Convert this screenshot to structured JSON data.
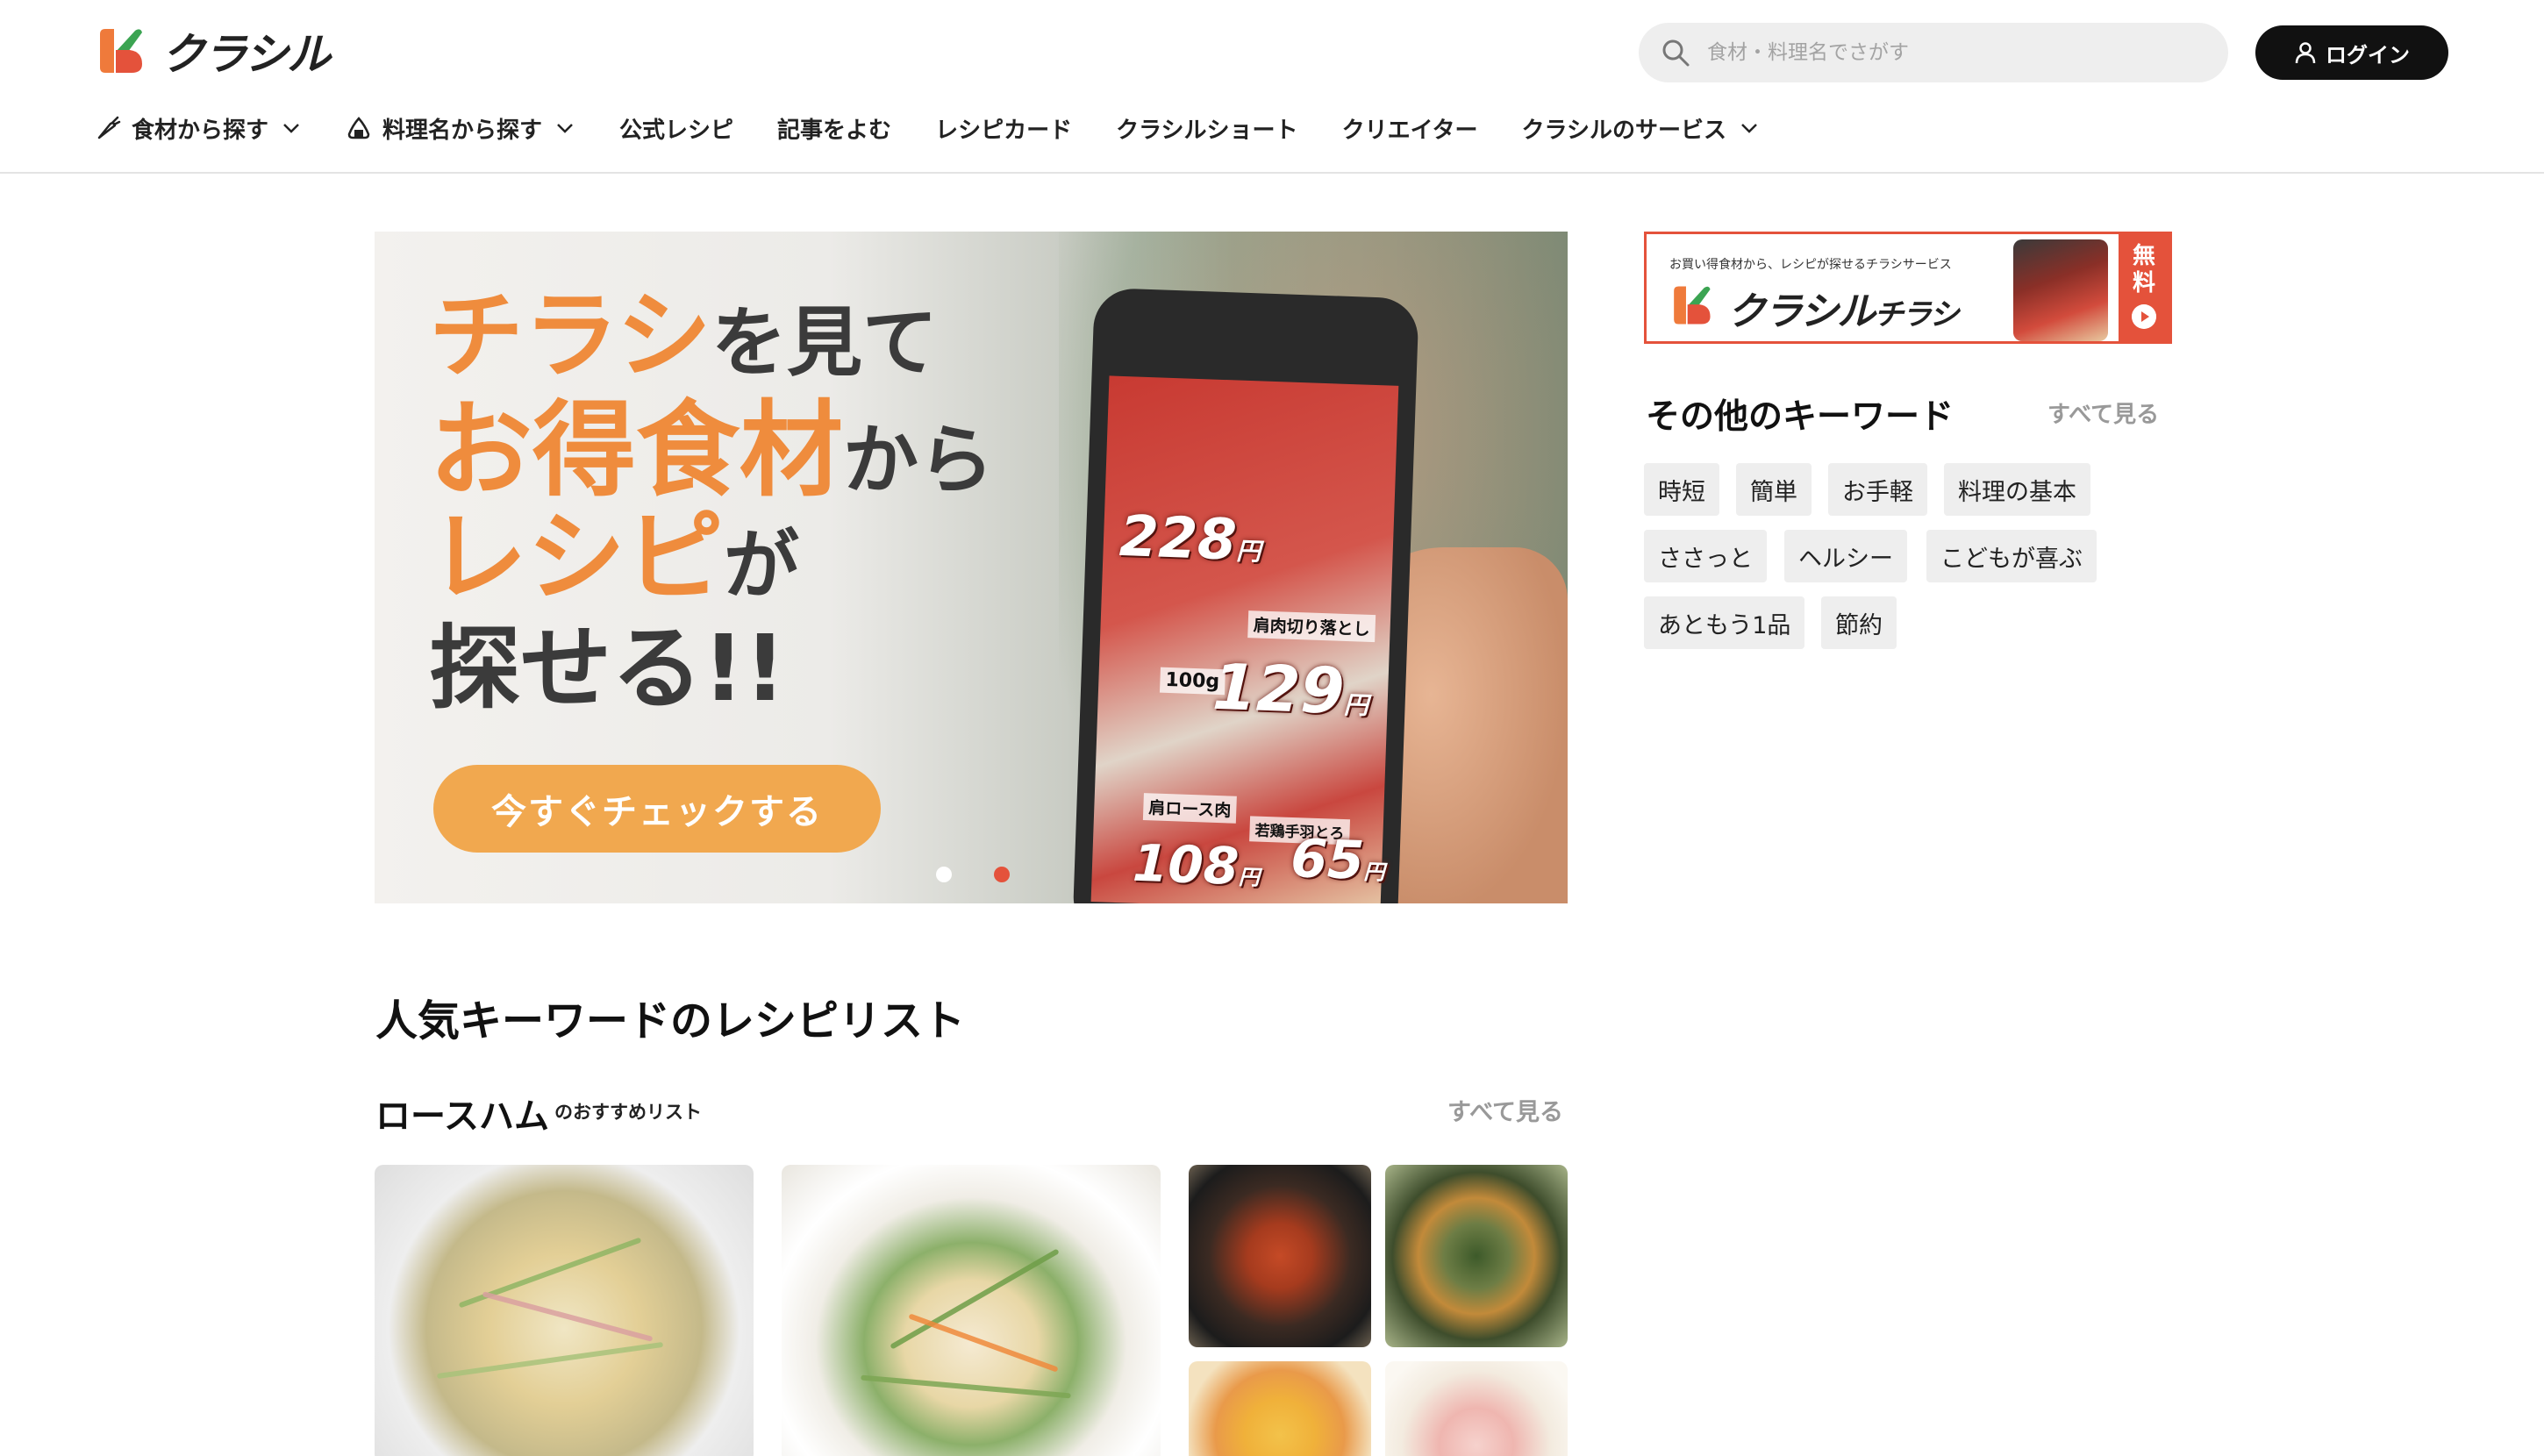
{
  "header": {
    "logo_text": "クラシル",
    "search_placeholder": "食材・料理名でさがす",
    "login_label": "ログイン"
  },
  "nav": [
    {
      "label": "食材から探す",
      "has_dropdown": true,
      "icon": "carrot-icon"
    },
    {
      "label": "料理名から探す",
      "has_dropdown": true,
      "icon": "onigiri-icon"
    },
    {
      "label": "公式レシピ",
      "has_dropdown": false
    },
    {
      "label": "記事をよむ",
      "has_dropdown": false
    },
    {
      "label": "レシピカード",
      "has_dropdown": false
    },
    {
      "label": "クラシルショート",
      "has_dropdown": false
    },
    {
      "label": "クリエイター",
      "has_dropdown": false
    },
    {
      "label": "クラシルのサービス",
      "has_dropdown": true
    }
  ],
  "hero": {
    "line1_highlight": "チラシ",
    "line1_rest": "を見て",
    "line2_highlight": "お得食材",
    "line2_rest": "から",
    "line3_highlight": "レシピ",
    "line3_rest": "が",
    "line4": "探せる!!",
    "cta_label": "今すぐチェックする",
    "phone": {
      "price_1": "228",
      "price_2": "129",
      "price_3": "108",
      "price_4": "65",
      "label_1": "肩肉切り落とし",
      "label_2": "肩ロース肉",
      "label_3": "若鶏手羽とろ",
      "weight_label": "100g",
      "yen": "円"
    },
    "slide_count": 2,
    "active_slide": 2,
    "colors": {
      "highlight": "#ef8c3d",
      "cta": "#f1a84f",
      "dot_active": "#e4523b",
      "dot_inactive": "#ffffff"
    }
  },
  "ad": {
    "tagline": "お買い得食材から、レシピが探せるチラシサービス",
    "brand": "クラシル",
    "brand_suffix": "チラシ",
    "free_label_1": "無",
    "free_label_2": "料"
  },
  "keywords": {
    "title": "その他のキーワード",
    "see_all": "すべて見る",
    "tags": [
      "時短",
      "簡単",
      "お手軽",
      "料理の基本",
      "ささっと",
      "ヘルシー",
      "こどもが喜ぶ",
      "あともう1品",
      "節約"
    ]
  },
  "recipe_section": {
    "title": "人気キーワードのレシピリスト",
    "keyword": "ロースハム",
    "keyword_note": "のおすすめリスト",
    "see_all": "すべて見る"
  },
  "brand_colors": {
    "accent": "#e4523b",
    "logo_orange": "#ef7a3b",
    "logo_green": "#3ba452"
  }
}
